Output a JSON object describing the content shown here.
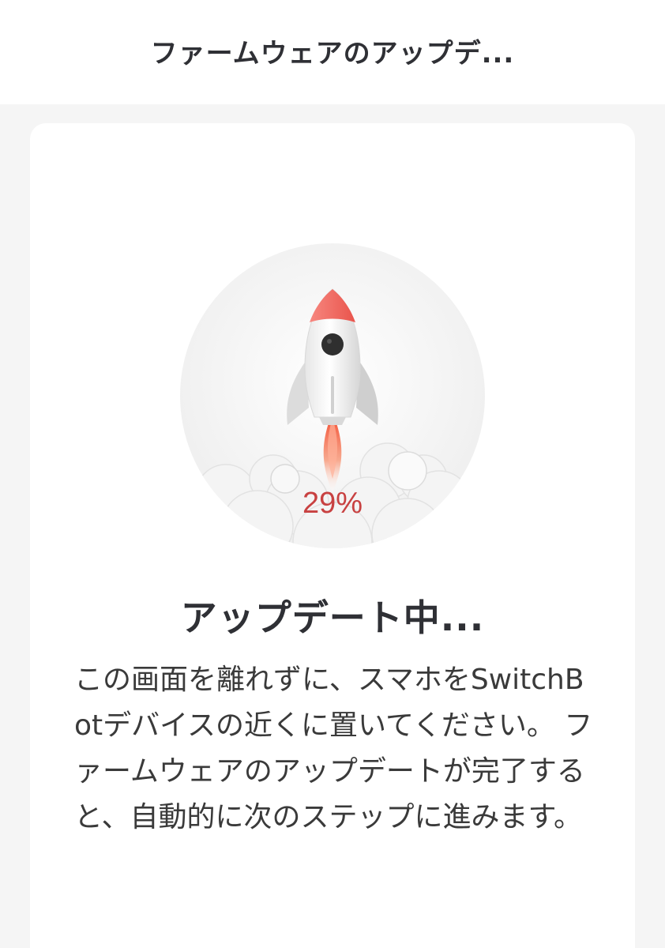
{
  "header": {
    "title": "ファームウェアのアップデ..."
  },
  "update": {
    "progress_percent": 29,
    "progress_label": "29%",
    "status_title": "アップデート中...",
    "message": "この画面を離れずに、スマホをSwitchBotデバイスの近くに置いてください。 ファームウェアのアップデートが完了すると、自動的に次のステップに進みます。"
  },
  "illustration": {
    "icon": "rocket-launch-icon"
  },
  "colors": {
    "accent": "#c84141",
    "rocket_tip": "#f06a63",
    "flame": "#f4603d",
    "background": "#f5f5f5",
    "card": "#ffffff"
  }
}
